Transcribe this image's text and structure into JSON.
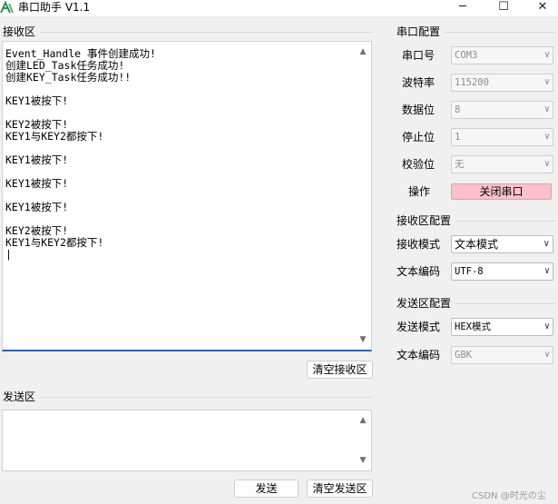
{
  "window": {
    "title": "串口助手 V1.1",
    "min": "─",
    "max": "☐",
    "close": "✕"
  },
  "receive": {
    "title": "接收区",
    "text": "Event_Handle 事件创建成功!\n创建LED_Task任务成功!\n创建KEY_Task任务成功!!\n\nKEY1被按下!\n\nKEY2被按下!\nKEY1与KEY2都按下!\n\nKEY1被按下!\n\nKEY1被按下!\n\nKEY1被按下!\n\nKEY2被按下!\nKEY1与KEY2都按下!\n|",
    "clear_label": "清空接收区"
  },
  "send": {
    "title": "发送区",
    "text": "",
    "send_label": "发送",
    "clear_label": "清空发送区"
  },
  "port_config": {
    "title": "串口配置",
    "port_label": "串口号",
    "port_value": "COM3",
    "baud_label": "波特率",
    "baud_value": "115200",
    "data_label": "数据位",
    "data_value": "8",
    "stop_label": "停止位",
    "stop_value": "1",
    "parity_label": "校验位",
    "parity_value": "无",
    "op_label": "操作",
    "close_port_label": "关闭串口",
    "close_port_color": "#ffc0cb"
  },
  "recv_config": {
    "title": "接收区配置",
    "mode_label": "接收模式",
    "mode_value": "文本模式",
    "enc_label": "文本编码",
    "enc_value": "UTF-8"
  },
  "send_config": {
    "title": "发送区配置",
    "mode_label": "发送模式",
    "mode_value": "HEX模式",
    "enc_label": "文本编码",
    "enc_value": "GBK"
  },
  "watermark": "CSDN @时光の尘",
  "colors": {
    "accent_underline": "#2a63b6",
    "background": "#f0f0f0"
  }
}
